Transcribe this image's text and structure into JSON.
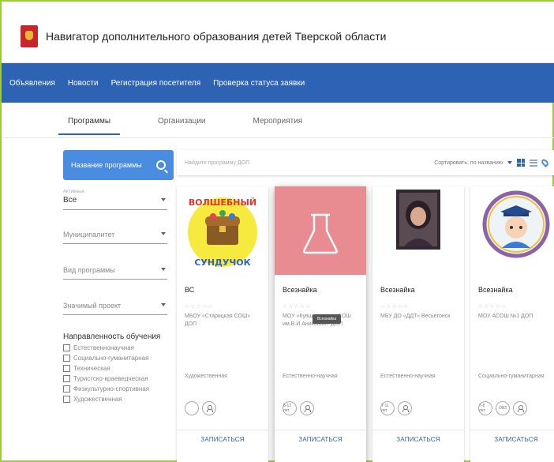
{
  "header": {
    "title": "Навигатор дополнительного образования детей Тверской области"
  },
  "nav": {
    "items": [
      "Объявления",
      "Новости",
      "Регистрация посетителя",
      "Проверка статуса заявки"
    ]
  },
  "tabs": [
    "Программы",
    "Организации",
    "Мероприятия"
  ],
  "sidebar": {
    "search_label": "Название программы",
    "filters": [
      {
        "label": "Активные",
        "value": "Все"
      },
      {
        "label": "Муниципалитет",
        "value": ""
      },
      {
        "label": "Вид программы",
        "value": ""
      },
      {
        "label": "Значимый проект",
        "value": ""
      }
    ],
    "directions_title": "Направленность обучения",
    "directions": [
      "Естественнонаучная",
      "Социально-гуманитарная",
      "Техническая",
      "Туристско-краеведческая",
      "Физкультурно-спортивная",
      "Художественная"
    ]
  },
  "toolbar": {
    "search_placeholder": "Найдите программу ДОП",
    "sort_label": "Сортировать: по названию"
  },
  "cards": [
    {
      "title": "ВС",
      "org": "МБОУ «Старицкая СОШ» ДОП",
      "direction": "Художественная",
      "button": "ЗАПИСАТЬСЯ",
      "badge1": "",
      "badge2": ""
    },
    {
      "title": "Всезнайка",
      "org": "МОУ «Кувшиновская СОШ им.В.И.Аниковая» ДОП",
      "direction": "Естественно-научная",
      "button": "ЗАПИСАТЬСЯ",
      "badge1": "5-12 лет",
      "badge2": ""
    },
    {
      "title": "Всезнайка",
      "org": "МБУ ДО «ДДТ» Весьегонск",
      "direction": "Естественно-научная",
      "button": "ЗАПИСАТЬСЯ",
      "badge1": "7-11 лет",
      "badge2": ""
    },
    {
      "title": "Всезнайка",
      "org": "МОУ АСОШ №1 ДОП",
      "direction": "Социально-гуманитарная",
      "button": "ЗАПИСАТЬСЯ",
      "badge1": "7-8 лет",
      "badge2": "ОВЗ"
    }
  ],
  "tooltip": "Всезнайка",
  "card_images": {
    "card1_text_top": "ВОЛШЕБНЫЙ",
    "card1_text_bottom": "СУНДУЧОК"
  },
  "colors": {
    "nav": "#2e63b4",
    "accent": "#4a8de0",
    "card2_bg": "#e98c92",
    "frame": "#9ccc3a"
  }
}
